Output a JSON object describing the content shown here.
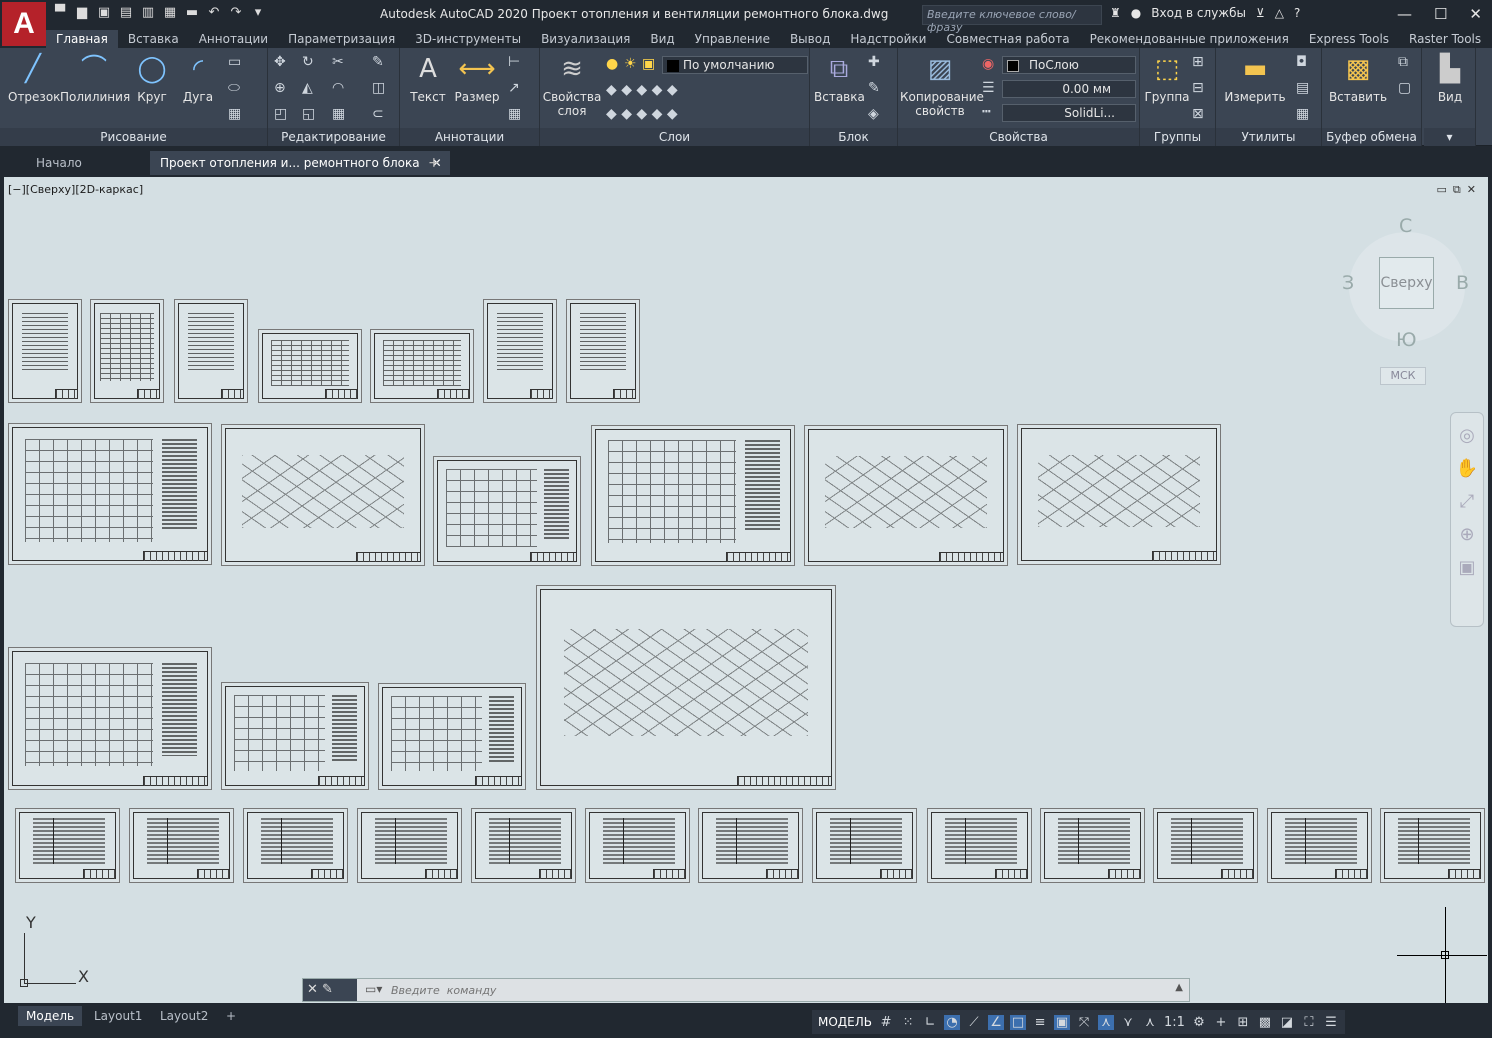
{
  "app": {
    "title": "Autodesk AutoCAD 2020    Проект отопления и вентиляции ремонтного блока.dwg",
    "logo": "A",
    "search_placeholder": "Введите ключевое слово/фразу",
    "signin": "Вход в службы"
  },
  "menu": [
    "Главная",
    "Вставка",
    "Аннотации",
    "Параметризация",
    "3D-инструменты",
    "Визуализация",
    "Вид",
    "Управление",
    "Вывод",
    "Надстройки",
    "Совместная работа",
    "Рекомендованные приложения",
    "Express Tools",
    "Raster Tools"
  ],
  "ribbon": {
    "draw": {
      "title": "Рисование",
      "line": "Отрезок",
      "polyline": "Полилиния",
      "circle": "Круг",
      "arc": "Дуга"
    },
    "modify": {
      "title": "Редактирование"
    },
    "annot": {
      "title": "Аннотации",
      "text": "Текст",
      "dim": "Размер"
    },
    "layers": {
      "title": "Слои",
      "props": "Свойства слоя",
      "current": "По умолчанию"
    },
    "block": {
      "title": "Блок",
      "insert": "Вставка"
    },
    "props": {
      "title": "Свойства",
      "match": "Копирование свойств",
      "color": "ПоСлою",
      "lineweight": "0.00 мм",
      "linetype": "SolidLi..."
    },
    "groups": {
      "title": "Группы",
      "group": "Группа"
    },
    "utils": {
      "title": "Утилиты",
      "measure": "Измерить"
    },
    "clip": {
      "title": "Буфер обмена",
      "paste": "Вставить"
    },
    "view": {
      "title": "Вид"
    }
  },
  "doc_tabs": {
    "start": "Начало",
    "current": "Проект отопления и... ремонтного блока",
    "close": "✕",
    "add": "+"
  },
  "viewport": {
    "label": "[−][Сверху][2D-каркас]",
    "cube_face": "Сверху",
    "n": "С",
    "s": "Ю",
    "w": "З",
    "e": "В",
    "ucs": "МСК"
  },
  "command": {
    "placeholder": "Введите  команду"
  },
  "layouts": [
    "Модель",
    "Layout1",
    "Layout2",
    "+"
  ],
  "status": {
    "model": "МОДЕЛЬ",
    "scale": "1:1"
  },
  "axis": {
    "y": "Y",
    "x": "X"
  }
}
